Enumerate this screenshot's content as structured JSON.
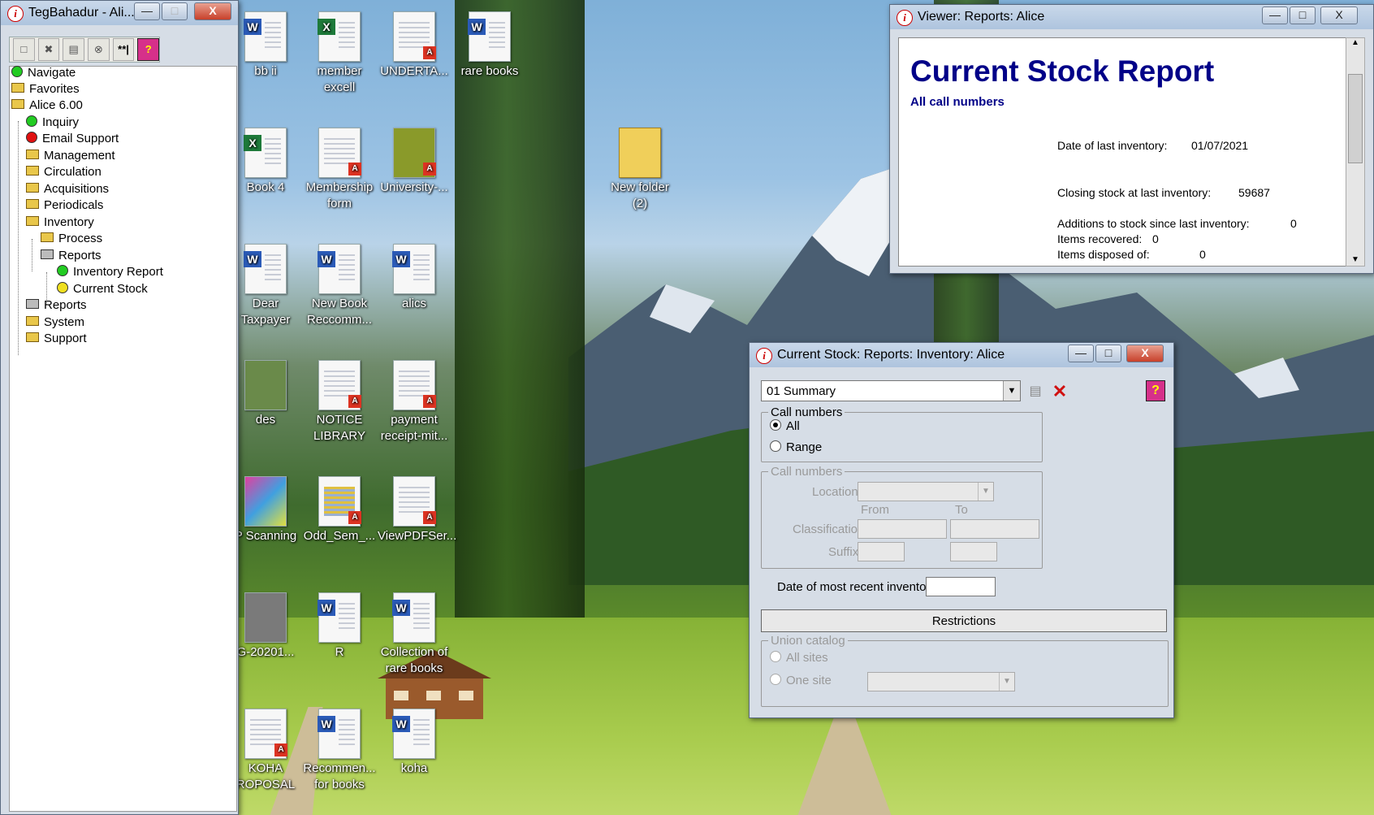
{
  "desktop": {
    "icons": [
      {
        "label": "bb ii",
        "type": "word"
      },
      {
        "label": "member excell",
        "type": "excel"
      },
      {
        "label": "UNDERTA...",
        "type": "pdf"
      },
      {
        "label": "rare books",
        "type": "word"
      },
      {
        "label": "Book 4",
        "type": "excel"
      },
      {
        "label": "Membership form",
        "type": "pdf"
      },
      {
        "label": "University-...",
        "type": "pdf"
      },
      {
        "label": "New folder (2)",
        "type": "folder"
      },
      {
        "label": "Dear Taxpayer",
        "type": "word"
      },
      {
        "label": "New Book Reccomm...",
        "type": "word"
      },
      {
        "label": "alics",
        "type": "word"
      },
      {
        "label": "des",
        "type": "image"
      },
      {
        "label": "NOTICE LIBRARY",
        "type": "pdf"
      },
      {
        "label": "payment receipt-mit...",
        "type": "pdf"
      },
      {
        "label": "P Scanning",
        "type": "scanner"
      },
      {
        "label": "Odd_Sem_...",
        "type": "pdf"
      },
      {
        "label": "ViewPDFSer...",
        "type": "pdf"
      },
      {
        "label": "G-20201...",
        "type": "image"
      },
      {
        "label": "R",
        "type": "word"
      },
      {
        "label": "Collection of rare books",
        "type": "word"
      },
      {
        "label": "KOHA ROPOSAL",
        "type": "pdf"
      },
      {
        "label": "Recommen... for books",
        "type": "word"
      },
      {
        "label": "koha",
        "type": "word"
      }
    ]
  },
  "navigator": {
    "title": "TegBahadur - Ali...",
    "toolbar": {
      "placeholder_label": "**|",
      "help_label": "?"
    },
    "tree": [
      {
        "label": "Navigate",
        "icon": "green-dot"
      },
      {
        "label": "Favorites",
        "icon": "folder"
      },
      {
        "label": "Alice 6.00",
        "icon": "folder"
      },
      {
        "label": "Inquiry",
        "icon": "green-dot"
      },
      {
        "label": "Email Support",
        "icon": "red-dot"
      },
      {
        "label": "Management",
        "icon": "folder"
      },
      {
        "label": "Circulation",
        "icon": "folder"
      },
      {
        "label": "Acquisitions",
        "icon": "folder"
      },
      {
        "label": "Periodicals",
        "icon": "folder"
      },
      {
        "label": "Inventory",
        "icon": "folder"
      },
      {
        "label": "Process",
        "icon": "folder"
      },
      {
        "label": "Reports",
        "icon": "printer"
      },
      {
        "label": "Inventory Report",
        "icon": "green-dot"
      },
      {
        "label": "Current Stock",
        "icon": "yellow-dot"
      },
      {
        "label": "Reports",
        "icon": "printer"
      },
      {
        "label": "System",
        "icon": "folder"
      },
      {
        "label": "Support",
        "icon": "folder"
      }
    ]
  },
  "viewer": {
    "title": "Viewer: Reports: Alice",
    "report_title": "Current Stock Report",
    "subtitle": "All call numbers",
    "rows": [
      {
        "label": "Date of last inventory:",
        "value": "01/07/2021"
      },
      {
        "label": "Closing stock at last inventory:",
        "value": "59687"
      },
      {
        "label": "Additions to stock since last inventory:",
        "value": "0"
      },
      {
        "label": "Items recovered:",
        "value": "0"
      },
      {
        "label": "Items disposed of:",
        "value": "0"
      }
    ]
  },
  "stock_dialog": {
    "title": "Current Stock: Reports: Inventory: Alice",
    "report_type": "01 Summary",
    "help_label": "?",
    "call_numbers_group": {
      "legend": "Call numbers",
      "options": [
        "All",
        "Range"
      ],
      "selected": "All"
    },
    "range_group": {
      "legend": "Call numbers",
      "location_label": "Location",
      "from_label": "From",
      "to_label": "To",
      "classification_label": "Classification",
      "suffix_label": "Suffix"
    },
    "recent_inventory_label": "Date of most recent inventory",
    "recent_inventory_value": "",
    "restrictions_label": "Restrictions",
    "union_group": {
      "legend": "Union catalog",
      "options": [
        "All sites",
        "One site"
      ]
    }
  },
  "colors": {
    "report_title": "#000088",
    "close_button": "#c8402a",
    "help_button": "#d6308a"
  }
}
